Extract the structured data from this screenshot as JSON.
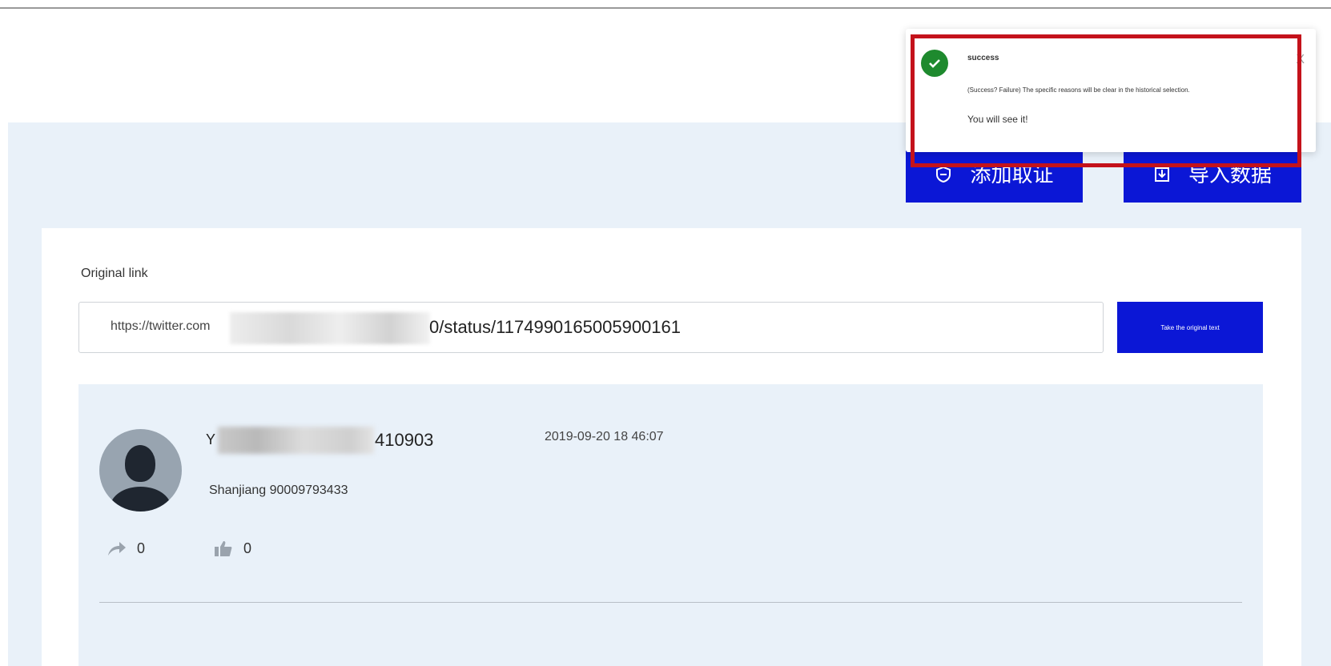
{
  "toolbar": {
    "add_label": "添加取证",
    "import_label": "导入数据"
  },
  "form": {
    "label": "Original link",
    "url_prefix": "https://twitter.com",
    "url_suffix": "0/status/1174990165005900161",
    "fetch_label": "Take the original text"
  },
  "post": {
    "author_prefix": "Y",
    "author_suffix": "410903",
    "time": "2019-09-20 18 46:07",
    "location": "Shanjiang 90009793433",
    "shares": "0",
    "likes": "0"
  },
  "toast": {
    "title": "success",
    "message": "(Success? Failure) The specific reasons will be clear in the historical selection.",
    "sub": "You will see it!",
    "close": "X"
  },
  "colors": {
    "primary": "#0b17d6",
    "success": "#1e8a2e",
    "highlight": "#c4121b",
    "background": "#e9f1f9"
  },
  "icons": {
    "add": "shield-plus-icon",
    "import": "import-icon",
    "share": "share-arrow-icon",
    "like": "thumbs-up-icon",
    "check": "check-circle-icon"
  }
}
